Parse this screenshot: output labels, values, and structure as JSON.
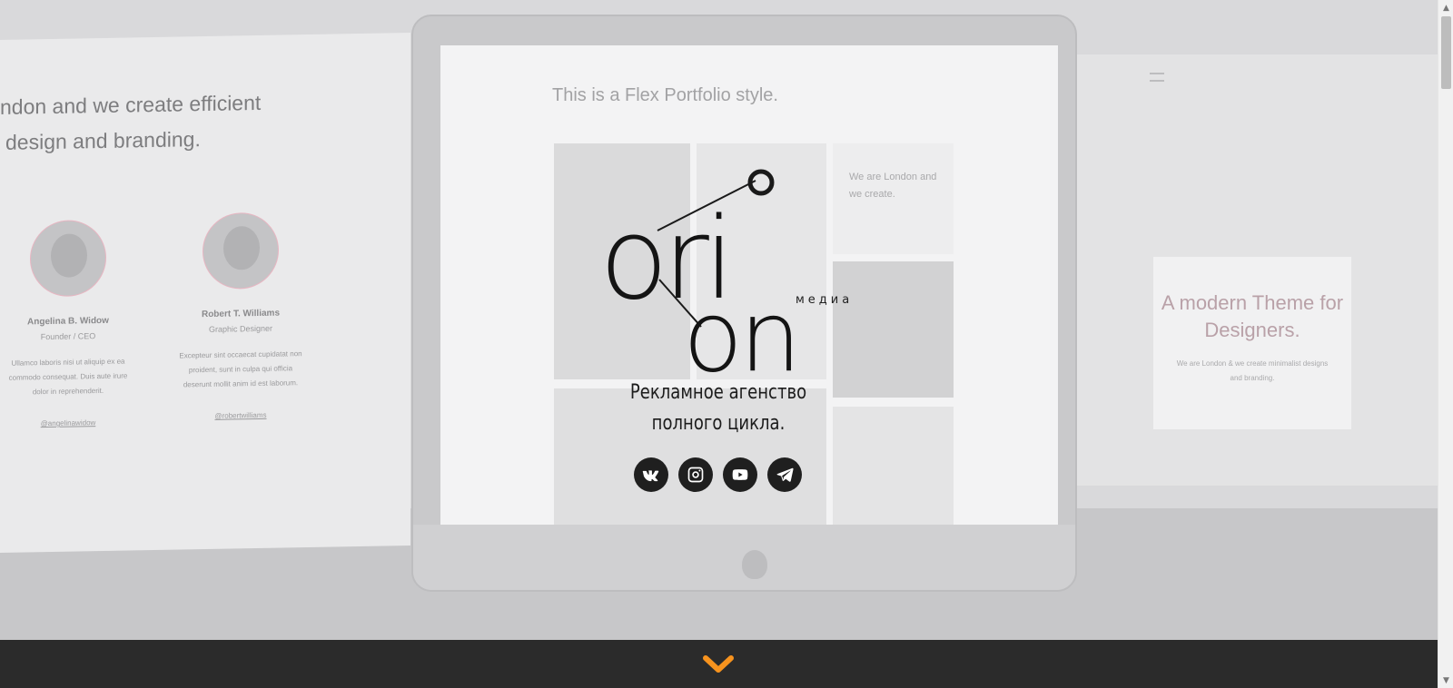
{
  "background": {
    "left_panel": {
      "tagline_lines": [
        "ndon and we create efficient",
        "design and branding."
      ],
      "members": [
        {
          "name": "Angelina B. Widow",
          "role": "Founder / CEO",
          "bio": "Ullamco laboris nisi ut aliquip ex ea commodo consequat. Duis aute irure dolor in reprehenderit.",
          "handle": "@angelinawidow"
        },
        {
          "name": "Robert T. Williams",
          "role": "Graphic Designer",
          "bio": "Excepteur sint occaecat cupidatat non proident, sunt in culpa qui officia deserunt mollit anim id est laborum.",
          "handle": "@robertwilliams"
        }
      ]
    },
    "monitor": {
      "flex_text": "This is a Flex Portfolio style.",
      "tile_text": "We are London and we create."
    },
    "right_panel": {
      "card_heading": "A modern Theme for Designers.",
      "card_text": "We are London & we create minimalist designs and branding."
    }
  },
  "hero": {
    "logo_word_top": "ori",
    "logo_word_bottom": "on",
    "logo_sub": "медиа",
    "tagline_line1": "Рекламное агенство",
    "tagline_line2": "полного цикла.",
    "socials": [
      {
        "label": "VK",
        "icon": "vk-icon"
      },
      {
        "label": "Instagram",
        "icon": "instagram-icon"
      },
      {
        "label": "YouTube",
        "icon": "youtube-icon"
      },
      {
        "label": "Telegram",
        "icon": "telegram-icon"
      }
    ]
  },
  "bottom_bar": {
    "arrow_icon": "chevron-down-icon",
    "accent": "#f7931e",
    "bg": "#2b2b2b"
  },
  "scrollbar": {
    "up": "▲",
    "down": "▼"
  }
}
